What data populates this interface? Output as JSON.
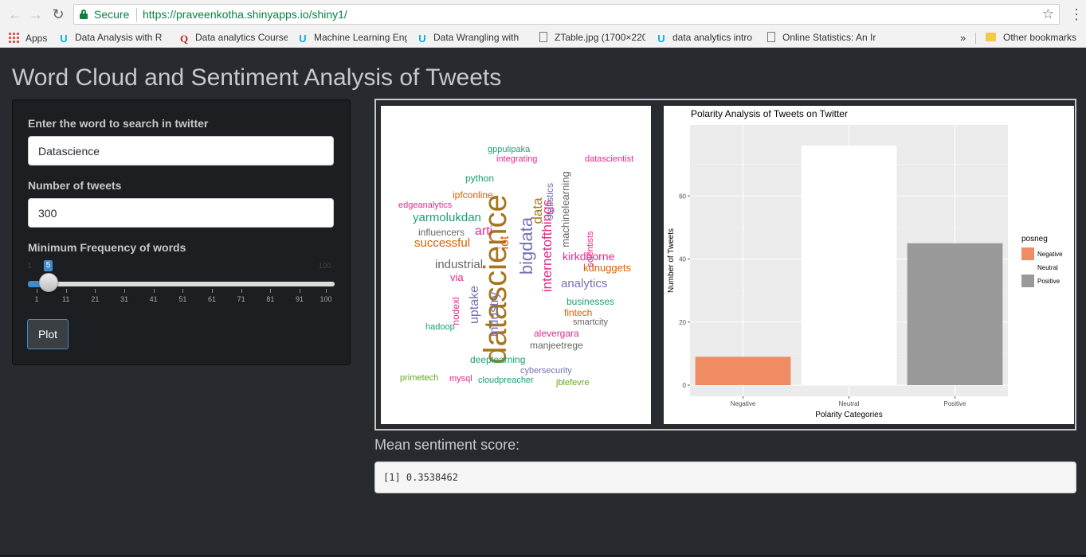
{
  "browser": {
    "secure_label": "Secure",
    "url": "https://praveenkotha.shinyapps.io/shiny1/",
    "bookmarks": [
      {
        "label": "Apps",
        "icon": "apps-grid-icon"
      },
      {
        "label": "Data Analysis with R",
        "icon": "udacity-icon"
      },
      {
        "label": "Data analytics Course",
        "icon": "quora-icon"
      },
      {
        "label": "Machine Learning Eng",
        "icon": "udacity-icon"
      },
      {
        "label": "Data Wrangling with",
        "icon": "udacity-icon"
      },
      {
        "label": "ZTable.jpg (1700×220",
        "icon": "page-icon"
      },
      {
        "label": "data analytics intro",
        "icon": "udacity-icon"
      },
      {
        "label": "Online Statistics: An Ir",
        "icon": "page-icon"
      }
    ],
    "overflow_label": "»",
    "other_bookmarks": "Other bookmarks"
  },
  "app": {
    "title": "Word Cloud and Sentiment Analysis of Tweets",
    "sidebar": {
      "search_label": "Enter the word to search in twitter",
      "search_value": "Datascience",
      "tweets_label": "Number of tweets",
      "tweets_value": "300",
      "freq_label": "Minimum Frequency of words",
      "slider": {
        "min": 1,
        "max": 100,
        "value": 5,
        "value_label": "5",
        "min_label": "1",
        "max_label": "100",
        "ticks": [
          "1",
          "11",
          "21",
          "31",
          "41",
          "51",
          "61",
          "71",
          "81",
          "91",
          "100"
        ]
      },
      "plot_button": "Plot"
    },
    "wordcloud": {
      "words": [
        {
          "text": "datascience",
          "color": "#a6761d",
          "size": 40,
          "big": true
        },
        {
          "text": "bigdata",
          "color": "#7570b3",
          "size": 22
        },
        {
          "text": "data",
          "color": "#a6761d",
          "size": 17
        },
        {
          "text": "internetofthings",
          "color": "#e7298a",
          "size": 17
        },
        {
          "text": "iot",
          "color": "#d95f02",
          "size": 16
        },
        {
          "text": "industry",
          "color": "#7570b3",
          "size": 16
        },
        {
          "text": "uptake",
          "color": "#7570b3",
          "size": 16
        },
        {
          "text": "yarmolukdan",
          "color": "#1b9e77",
          "size": 15
        },
        {
          "text": "successful",
          "color": "#d95f02",
          "size": 15
        },
        {
          "text": "industrial",
          "color": "#666666",
          "size": 15
        },
        {
          "text": "arti",
          "color": "#e7298a",
          "size": 16
        },
        {
          "text": "analytics",
          "color": "#7570b3",
          "size": 15
        },
        {
          "text": "kirkdborne",
          "color": "#e7298a",
          "size": 14
        },
        {
          "text": "machinelearning",
          "color": "#666666",
          "size": 13
        },
        {
          "text": "kdnuggets",
          "color": "#d95f02",
          "size": 13
        },
        {
          "text": "businesses",
          "color": "#1b9e77",
          "size": 12
        },
        {
          "text": "fintech",
          "color": "#d95f02",
          "size": 12
        },
        {
          "text": "alevergara",
          "color": "#e7298a",
          "size": 12
        },
        {
          "text": "manjeetrege",
          "color": "#666666",
          "size": 12
        },
        {
          "text": "deeplearning",
          "color": "#1b9e77",
          "size": 12
        },
        {
          "text": "influencers",
          "color": "#666666",
          "size": 12
        },
        {
          "text": "ipfconline",
          "color": "#d95f02",
          "size": 12
        },
        {
          "text": "python",
          "color": "#1b9e77",
          "size": 12
        },
        {
          "text": "via",
          "color": "#e7298a",
          "size": 13
        },
        {
          "text": "nodexl",
          "color": "#e7298a",
          "size": 12
        },
        {
          "text": "edgeanalytics",
          "color": "#e7298a",
          "size": 11
        },
        {
          "text": "datascientist",
          "color": "#e7298a",
          "size": 11
        },
        {
          "text": "integrating",
          "color": "#e7298a",
          "size": 11
        },
        {
          "text": "gppulipaka",
          "color": "#1b9e77",
          "size": 11
        },
        {
          "text": "cybersecurity",
          "color": "#7570b3",
          "size": 11
        },
        {
          "text": "cloudpreacher",
          "color": "#1b9e77",
          "size": 11
        },
        {
          "text": "jblefevre",
          "color": "#66a61e",
          "size": 11
        },
        {
          "text": "primetech",
          "color": "#66a61e",
          "size": 11
        },
        {
          "text": "mysql",
          "color": "#e7298a",
          "size": 11
        },
        {
          "text": "smartcity",
          "color": "#666666",
          "size": 11
        },
        {
          "text": "statistics",
          "color": "#7570b3",
          "size": 12
        },
        {
          "text": "scientists",
          "color": "#e7298a",
          "size": 11
        },
        {
          "text": "hadoop",
          "color": "#1b9e77",
          "size": 11
        }
      ]
    },
    "chart_data": {
      "type": "bar",
      "title": "Polarity Analysis of  Tweets on Twitter",
      "xlabel": "Polarity Categories",
      "ylabel": "Number of Tweets",
      "categories": [
        "Negative",
        "Neutral",
        "Positive"
      ],
      "values": [
        9,
        76,
        45
      ],
      "colors": [
        "#f08c64",
        "#ffffff",
        "#999999"
      ],
      "ylim": [
        0,
        80
      ],
      "yticks": [
        "0",
        "20",
        "40",
        "60"
      ],
      "legend": {
        "title": "posneg",
        "placement": "right",
        "entries": [
          "Negative",
          "Neutral",
          "Positive"
        ]
      },
      "panel_bg": "#ebebeb"
    },
    "mean_label": "Mean sentiment score:",
    "mean_output": "[1] 0.3538462"
  }
}
